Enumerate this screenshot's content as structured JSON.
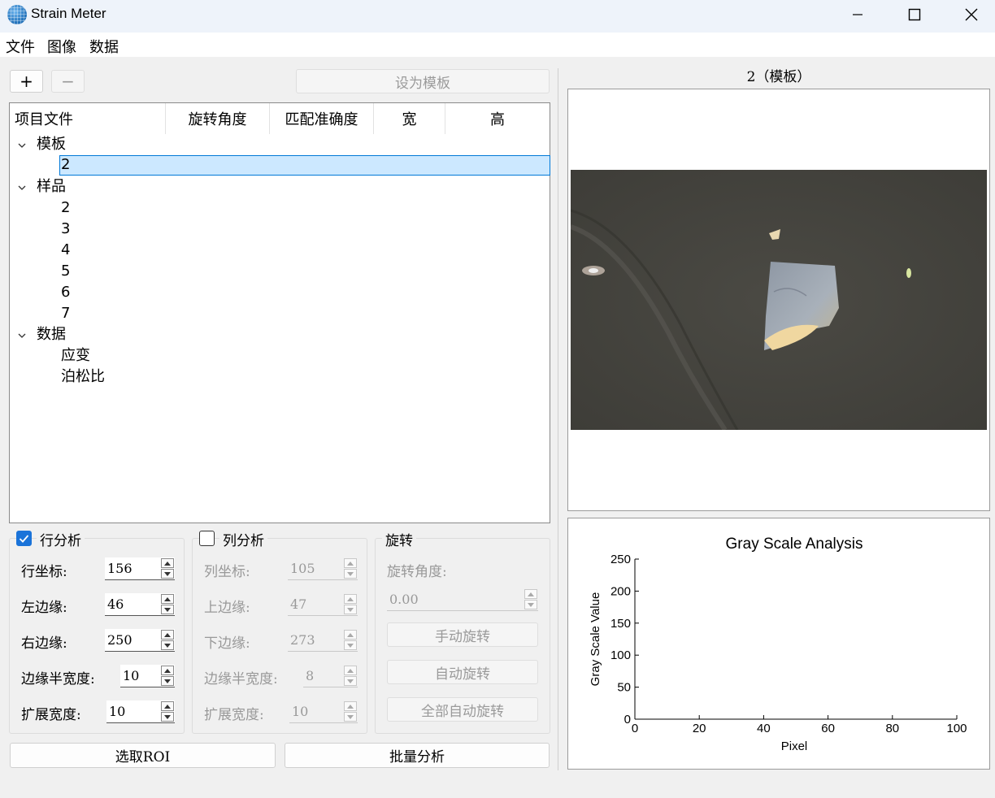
{
  "window": {
    "title": "Strain Meter"
  },
  "menu": [
    "文件",
    "图像",
    "数据"
  ],
  "toolbar": {
    "add_label": "+",
    "remove_label": "−",
    "set_template_label": "设为模板"
  },
  "tree": {
    "headers": [
      "项目文件",
      "旋转角度",
      "匹配准确度",
      "宽",
      "高"
    ],
    "groups": [
      {
        "label": "模板",
        "items": [
          "2"
        ]
      },
      {
        "label": "样品",
        "items": [
          "2",
          "3",
          "4",
          "5",
          "6",
          "7"
        ]
      },
      {
        "label": "数据",
        "items": [
          "应变",
          "泊松比"
        ]
      }
    ],
    "selected": "2"
  },
  "row_analysis": {
    "title": "行分析",
    "checked": true,
    "fields": [
      {
        "label": "行坐标:",
        "value": "156"
      },
      {
        "label": "左边缘:",
        "value": "46"
      },
      {
        "label": "右边缘:",
        "value": "250"
      },
      {
        "label": "边缘半宽度:",
        "value": "10"
      },
      {
        "label": "扩展宽度:",
        "value": "10"
      }
    ]
  },
  "col_analysis": {
    "title": "列分析",
    "checked": false,
    "fields": [
      {
        "label": "列坐标:",
        "value": "105"
      },
      {
        "label": "上边缘:",
        "value": "47"
      },
      {
        "label": "下边缘:",
        "value": "273"
      },
      {
        "label": "边缘半宽度:",
        "value": "8"
      },
      {
        "label": "扩展宽度:",
        "value": "10"
      }
    ]
  },
  "rotation": {
    "title": "旋转",
    "angle_label": "旋转角度:",
    "angle_value": "0.00",
    "manual_label": "手动旋转",
    "auto_label": "自动旋转",
    "auto_all_label": "全部自动旋转"
  },
  "bottom": {
    "roi_label": "选取ROI",
    "batch_label": "批量分析"
  },
  "image_view": {
    "title": "2（模板）"
  },
  "chart_data": {
    "type": "line",
    "title": "Gray Scale Analysis",
    "xlabel": "Pixel",
    "ylabel": "Gray Scale Value",
    "xlim": [
      0,
      100
    ],
    "ylim": [
      0,
      250
    ],
    "xticks": [
      0,
      20,
      40,
      60,
      80,
      100
    ],
    "yticks": [
      0,
      50,
      100,
      150,
      200,
      250
    ],
    "series": [],
    "grid": false
  },
  "colors": {
    "accent": "#1a73d9",
    "selection": "#cce8ff",
    "selection_border": "#0078d7"
  }
}
